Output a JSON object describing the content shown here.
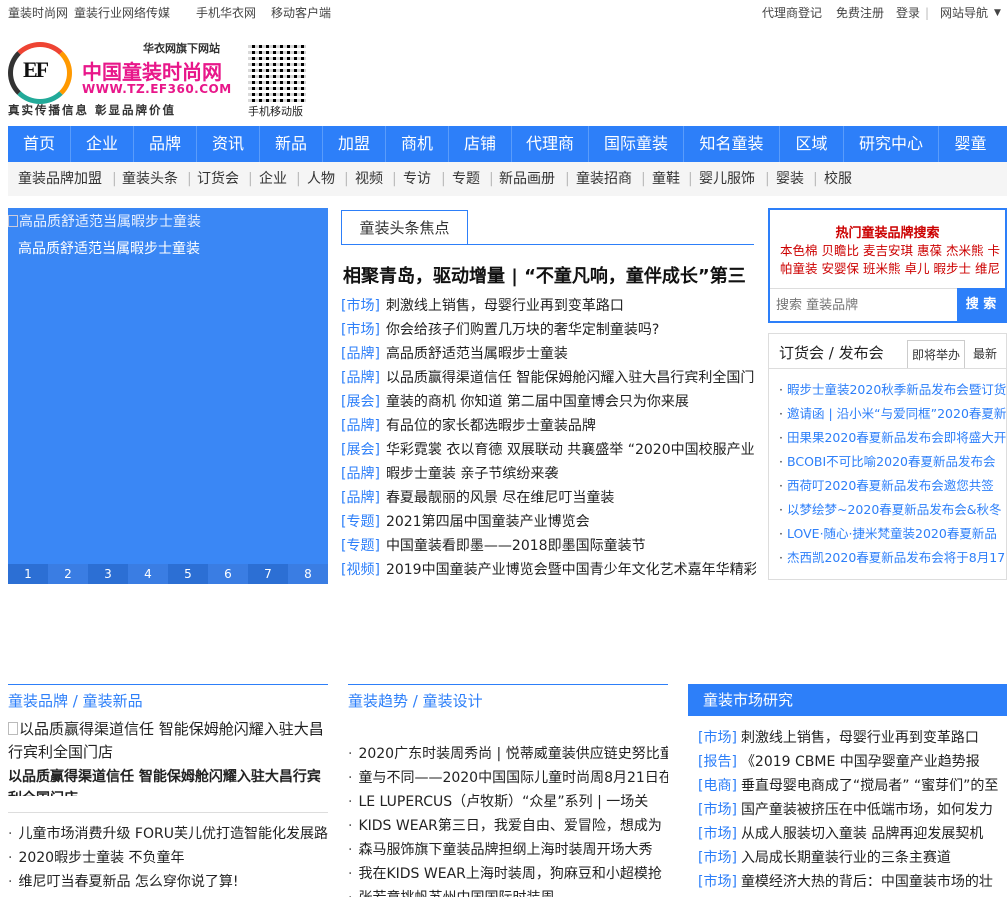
{
  "topbar": {
    "left": [
      "童装时尚网",
      "童装行业网络传媒",
      "手机华衣网",
      "移动客户端"
    ],
    "right": [
      "代理商登记",
      "免费注册",
      "登录",
      "网站导航"
    ]
  },
  "logo": {
    "mark": "EF",
    "sub": "华衣网旗下网站",
    "name": "中国童装时尚网",
    "url": "WWW.TZ.EF360.COM",
    "slogan": "真实传播信息 彰显品牌价值",
    "qr_label": "手机移动版"
  },
  "mainnav": [
    "首页",
    "企业",
    "品牌",
    "资讯",
    "新品",
    "加盟",
    "商机",
    "店铺",
    "代理商",
    "国际童装",
    "知名童装",
    "区域",
    "研究中心",
    "婴童"
  ],
  "subnav": [
    "童装品牌加盟",
    "童装头条",
    "订货会",
    "企业",
    "人物",
    "视频",
    "专访",
    "专题",
    "新品画册",
    "童装招商",
    "童鞋",
    "婴儿服饰",
    "婴装",
    "校服"
  ],
  "slider": {
    "img_alt": "高品质舒适范当属暇步士童装",
    "caption": "高品质舒适范当属暇步士童装",
    "pages": [
      "1",
      "2",
      "3",
      "4",
      "5",
      "6",
      "7",
      "8"
    ]
  },
  "headlines": {
    "tab": "童装头条焦点",
    "big": "相聚青岛，驱动增量 | “不童凡响，童伴成长”第三",
    "items": [
      {
        "tag": "[市场]",
        "text": "刺激线上销售，母婴行业再到变革路口"
      },
      {
        "tag": "[市场]",
        "text": "你会给孩子们购置几万块的奢华定制童装吗?"
      },
      {
        "tag": "[品牌]",
        "text": "高品质舒适范当属暇步士童装"
      },
      {
        "tag": "[品牌]",
        "text": "以品质赢得渠道信任 智能保姆舱闪耀入驻大昌行宾利全国门"
      },
      {
        "tag": "[展会]",
        "text": "童装的商机 你知道 第二届中国童博会只为你来展"
      },
      {
        "tag": "[品牌]",
        "text": "有品位的家长都选暇步士童装品牌"
      },
      {
        "tag": "[展会]",
        "text": "华彩霓裳 衣以育德 双展联动 共襄盛举 “2020中国校服产业"
      },
      {
        "tag": "[品牌]",
        "text": "暇步士童装 亲子节缤纷来袭"
      },
      {
        "tag": "[品牌]",
        "text": "春夏最靓丽的风景 尽在维尼叮当童装"
      },
      {
        "tag": "[专题]",
        "text": "2021第四届中国童装产业博览会"
      },
      {
        "tag": "[专题]",
        "text": "中国童装看即墨——2018即墨国际童装节"
      },
      {
        "tag": "[视频]",
        "text": "2019中国童装产业博览会暨中国青少年文化艺术嘉年华精彩"
      }
    ]
  },
  "hot_search": {
    "title": "热门童装品牌搜索",
    "links": [
      "本色棉",
      "贝瞻比",
      "麦吉安琪",
      "惠葆",
      "杰米熊",
      "卡帕童装",
      "安婴保",
      "班米熊",
      "卓儿",
      "暇步士",
      "维尼"
    ],
    "placeholder": "搜索 童装品牌",
    "button": "搜 索"
  },
  "orders": {
    "title": "订货会 / 发布会",
    "tab_active": "即将举办",
    "tab_other": "最新",
    "items": [
      "暇步士童装2020秋季新品发布会暨订货",
      "邀请函 | 沿小米“与爱同框”2020春夏新",
      "田果果2020春夏新品发布会即将盛大开",
      "BCOBI不可比喻2020春夏新品发布会",
      "西荷叮2020春夏新品发布会邀您共签",
      "以梦绘梦~2020春夏新品发布会&秋冬",
      "LOVE·随心·捷米梵童装2020春夏新品",
      "杰西凯2020春夏新品发布会将于8月17"
    ]
  },
  "brands": {
    "title": "童装品牌 / 童装新品",
    "img_alt": "以品质赢得渠道信任 智能保姆舱闪耀入驻大昌行宾利全国门店",
    "caption": "以品质赢得渠道信任 智能保姆舱闪耀入驻大昌行宾利全国门店",
    "items": [
      "儿童市场消费升级 FORU芙儿优打造智能化发展路",
      "2020暇步士童装 不负童年",
      "维尼叮当春夏新品 怎么穿你说了算!"
    ]
  },
  "trends": {
    "title": "童装趋势 / 童装设计",
    "items": [
      "2020广东时装周秀尚 | 悦蒂威童装供应链史努比童",
      "童与不同——2020中国国际儿童时尚周8月21日在",
      "LE LUPERCUS（卢牧斯）“众星”系列 | 一场关",
      "KIDS WEAR第三日，我爱自由、爱冒险，想成为",
      "森马服饰旗下童装品牌担纲上海时装周开场大秀",
      "我在KIDS WEAR上海时装周，狗麻豆和小超模抢",
      "张若意挑帆苏州中国国际时装周"
    ]
  },
  "market": {
    "title": "童装市场研究",
    "items": [
      {
        "tag": "[市场]",
        "text": "刺激线上销售，母婴行业再到变革路口"
      },
      {
        "tag": "[报告]",
        "text": "《2019 CBME 中国孕婴童产业趋势报"
      },
      {
        "tag": "[电商]",
        "text": "垂直母婴电商成了“搅局者” “蜜芽们”的至"
      },
      {
        "tag": "[市场]",
        "text": "国产童装被挤压在中低端市场，如何发力"
      },
      {
        "tag": "[市场]",
        "text": "从成人服装切入童装 品牌再迎发展契机"
      },
      {
        "tag": "[市场]",
        "text": "入局成长期童装行业的三条主赛道"
      },
      {
        "tag": "[市场]",
        "text": "童模经济大热的背后：中国童装市场的壮"
      }
    ]
  }
}
